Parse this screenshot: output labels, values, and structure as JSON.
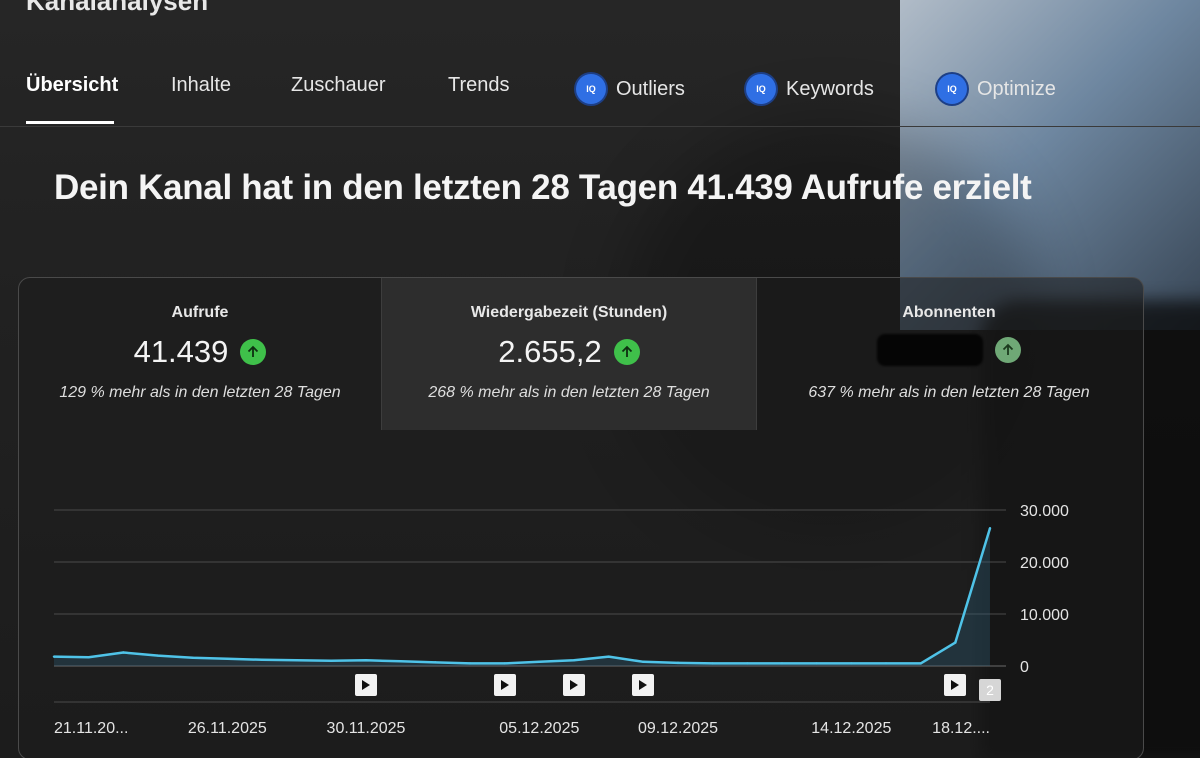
{
  "header": {
    "title": "Kanalanalysen"
  },
  "tabs": [
    {
      "label": "Übersicht",
      "active": true
    },
    {
      "label": "Inhalte"
    },
    {
      "label": "Zuschauer"
    },
    {
      "label": "Trends"
    },
    {
      "label": "Outliers",
      "badge": "IQ"
    },
    {
      "label": "Keywords",
      "badge": "IQ"
    },
    {
      "label": "Optimize",
      "badge": "IQ"
    }
  ],
  "headline": "Dein Kanal hat in den letzten 28 Tagen 41.439 Aufrufe erzielt",
  "metrics": [
    {
      "title": "Aufrufe",
      "value": "41.439",
      "trend": "up",
      "sub": "129 % mehr als in den letzten 28 Tagen"
    },
    {
      "title": "Wiedergabezeit (Stunden)",
      "value": "2.655,2",
      "trend": "up",
      "sub": "268 % mehr als in den letzten 28 Tagen"
    },
    {
      "title": "Abonnenten",
      "value": "",
      "trend": "up",
      "sub": "637 % mehr als in den letzten 28 Tagen"
    }
  ],
  "colors": {
    "line": "#4fc3e8",
    "area": "#2f5f78",
    "up": "#3fc04a",
    "badge": "#2f6fe4"
  },
  "chart_data": {
    "type": "area",
    "x": [
      "21.11.2025",
      "22.11.2025",
      "23.11.2025",
      "24.11.2025",
      "25.11.2025",
      "26.11.2025",
      "27.11.2025",
      "28.11.2025",
      "29.11.2025",
      "30.11.2025",
      "01.12.2025",
      "02.12.2025",
      "03.12.2025",
      "04.12.2025",
      "05.12.2025",
      "06.12.2025",
      "07.12.2025",
      "08.12.2025",
      "09.12.2025",
      "10.12.2025",
      "11.12.2025",
      "12.12.2025",
      "13.12.2025",
      "14.12.2025",
      "15.12.2025",
      "16.12.2025",
      "17.12.2025",
      "18.12.2025"
    ],
    "values": [
      1800,
      1700,
      2600,
      2000,
      1600,
      1400,
      1200,
      1100,
      1000,
      1100,
      900,
      700,
      500,
      500,
      800,
      1100,
      1800,
      800,
      600,
      500,
      500,
      500,
      500,
      500,
      500,
      500,
      4500,
      26500
    ],
    "ylim": [
      0,
      30000
    ],
    "yticks": [
      "30.000",
      "20.000",
      "10.000",
      "0"
    ],
    "xtick_labels": [
      "21.11.20...",
      "26.11.2025",
      "30.11.2025",
      "05.12.2025",
      "09.12.2025",
      "14.12.2025",
      "18.12...."
    ],
    "video_markers": [
      "30.11.2025",
      "04.12.2025",
      "06.12.2025",
      "08.12.2025",
      "17.12.2025"
    ],
    "marker_count": "2",
    "grid": true
  }
}
